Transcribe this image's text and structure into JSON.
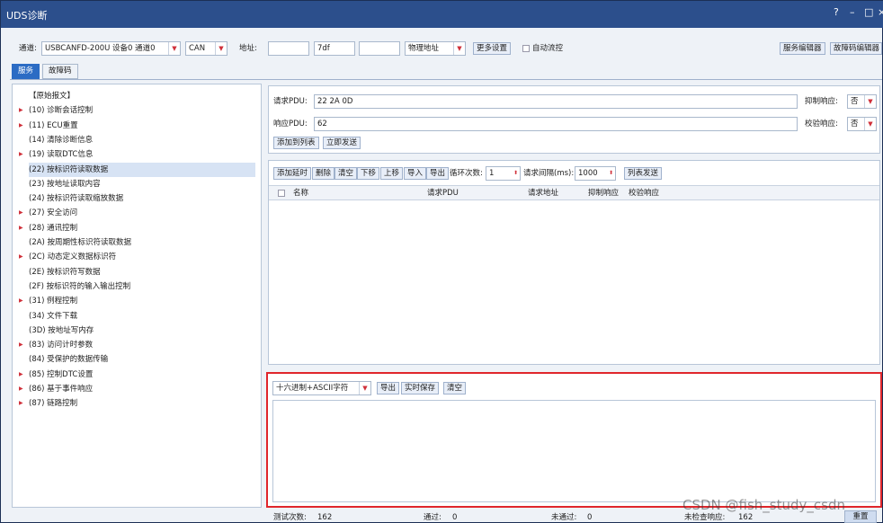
{
  "window": {
    "title": "UDS诊断",
    "controls": [
      "?",
      "–",
      "□",
      "×"
    ]
  },
  "topbar": {
    "channel_label": "通道:",
    "channel_value": "USBCANFD-200U 设备0 通道0",
    "proto_value": "CAN",
    "addr_label": "地址:",
    "addr1": "",
    "addr2": "7df",
    "addr3": "",
    "addr_type": "物理地址",
    "more_settings": "更多设置",
    "auto_flow": "自动流控",
    "service_editor": "服务编辑器",
    "dtc_editor": "故障码编辑器"
  },
  "tabs": [
    "服务",
    "故障码"
  ],
  "tree": {
    "items": [
      {
        "label": "【原始报文】",
        "arrow": false
      },
      {
        "label": "(10) 诊断会话控制",
        "arrow": true
      },
      {
        "label": "(11) ECU重置",
        "arrow": true
      },
      {
        "label": "(14) 清除诊断信息",
        "arrow": false
      },
      {
        "label": "(19) 读取DTC信息",
        "arrow": true
      },
      {
        "label": "(22) 按标识符读取数据",
        "arrow": false
      },
      {
        "label": "(23) 按地址读取内容",
        "arrow": false
      },
      {
        "label": "(24) 按标识符读取缩放数据",
        "arrow": false
      },
      {
        "label": "(27) 安全访问",
        "arrow": true
      },
      {
        "label": "(28) 通讯控制",
        "arrow": true
      },
      {
        "label": "(2A) 按周期性标识符读取数据",
        "arrow": false
      },
      {
        "label": "(2C) 动态定义数据标识符",
        "arrow": true
      },
      {
        "label": "(2E) 按标识符写数据",
        "arrow": false
      },
      {
        "label": "(2F) 按标识符的输入输出控制",
        "arrow": false
      },
      {
        "label": "(31) 例程控制",
        "arrow": true
      },
      {
        "label": "(34) 文件下载",
        "arrow": false
      },
      {
        "label": "(3D) 按地址写内存",
        "arrow": false
      },
      {
        "label": "(83) 访问计时参数",
        "arrow": true
      },
      {
        "label": "(84) 受保护的数据传输",
        "arrow": false
      },
      {
        "label": "(85) 控制DTC设置",
        "arrow": true
      },
      {
        "label": "(86) 基于事件响应",
        "arrow": true
      },
      {
        "label": "(87) 链路控制",
        "arrow": true
      }
    ],
    "selected_index": 5
  },
  "request": {
    "req_label": "请求PDU:",
    "req_value": "22 2A 0D",
    "resp_label": "响应PDU:",
    "resp_value": "62",
    "suppress_label": "抑制响应:",
    "suppress_value": "否",
    "verify_label": "校验响应:",
    "verify_value": "否",
    "add_to_list": "添加到列表",
    "send_now": "立即发送"
  },
  "list_toolbar": {
    "add_delay": "添加延时",
    "delete": "删除",
    "clear": "清空",
    "down": "下移",
    "up": "上移",
    "import": "导入",
    "export": "导出",
    "loop_label": "循环次数:",
    "loop_value": "1",
    "interval_label": "请求间隔(ms):",
    "interval_value": "1000",
    "list_send": "列表发送"
  },
  "list_columns": [
    "名称",
    "请求PDU",
    "请求地址",
    "抑制响应",
    "校验响应"
  ],
  "log": {
    "mode": "十六进制+ASCII字符",
    "export": "导出",
    "realtime_save": "实时保存",
    "clear": "清空"
  },
  "status": {
    "tests_label": "测试次数:",
    "tests_value": "162",
    "pass_label": "通过:",
    "pass_value": "0",
    "fail_label": "未通过:",
    "fail_value": "0",
    "unchecked_label": "未检查响应:",
    "unchecked_value": "162",
    "reset": "重置"
  },
  "watermark": "CSDN @fish_study_csdn",
  "colors": {
    "titlebar": "#2c4f8c",
    "highlight_border": "#e0262b",
    "selected_row": "#d7e3f4"
  }
}
